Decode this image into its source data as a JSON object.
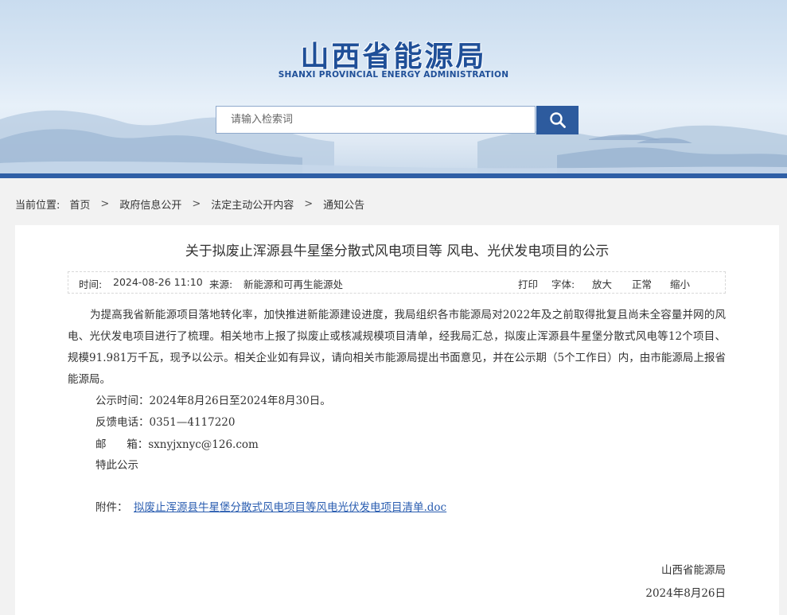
{
  "header": {
    "title": "山西省能源局",
    "subtitle": "SHANXI  PROVINCIAL  ENERGY  ADMINISTRATION",
    "search_placeholder": "请输入检索词"
  },
  "breadcrumb": {
    "label": "当前位置:",
    "items": [
      "首页",
      "政府信息公开",
      "法定主动公开内容",
      "通知公告"
    ],
    "separator": ">"
  },
  "article": {
    "title": "关于拟废止浑源县牛星堡分散式风电项目等 风电、光伏发电项目的公示",
    "meta": {
      "time_label": "时间:",
      "time_value": "2024-08-26 11:10",
      "source_label": "来源:",
      "source_value": "新能源和可再生能源处",
      "print": "打印",
      "font_label": "字体:",
      "font_large": "放大",
      "font_normal": "正常",
      "font_small": "缩小"
    },
    "paragraph": "为提高我省新能源项目落地转化率，加快推进新能源建设进度，我局组织各市能源局对2022年及之前取得批复且尚未全容量并网的风电、光伏发电项目进行了梳理。相关地市上报了拟废止或核减规模项目清单，经我局汇总，拟废止浑源县牛星堡分散式风电等12个项目、规模91.981万千瓦，现予以公示。相关企业如有异议，请向相关市能源局提出书面意见，并在公示期（5个工作日）内，由市能源局上报省能源局。",
    "notice_period": "公示时间：2024年8月26日至2024年8月30日。",
    "phone": "反馈电话：0351—4117220",
    "email": "邮      箱：sxnyjxnyc@126.com",
    "closing": "特此公示",
    "attachment_label": "附件：",
    "attachment_link": "拟废止浑源县牛星堡分散式风电项目等风电光伏发电项目清单.doc",
    "signature": "山西省能源局",
    "date": "2024年8月26日"
  },
  "colors": {
    "brand_blue": "#1f4f98",
    "search_button": "#2d5b9e",
    "link": "#2a5db0"
  }
}
